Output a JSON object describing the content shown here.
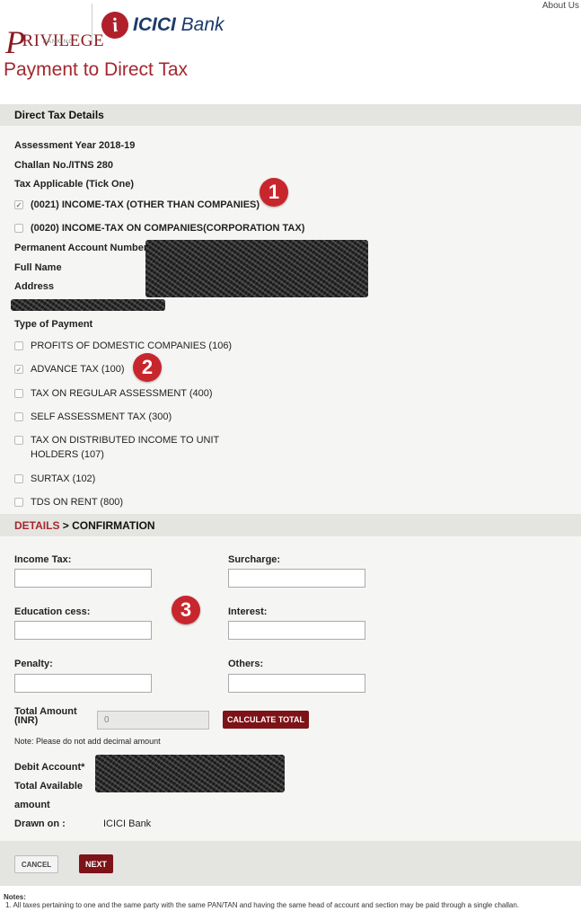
{
  "header": {
    "about_link": "About Us",
    "priv_logo_big": "P",
    "priv_logo_rest": "RIVILEGE",
    "priv_logo_sub": "BANKING",
    "icici_logo_mark": "i",
    "icici_logo_bold": "ICICI",
    "icici_logo_rest": " Bank"
  },
  "page_title": "Payment to Direct Tax",
  "direct_tax": {
    "section_title": "Direct Tax Details",
    "assessment_year": "Assessment Year 2018-19",
    "challan": "Challan No./ITNS 280",
    "tax_applicable_label": "Tax Applicable (Tick One)",
    "tax_options": [
      {
        "label": "(0021) INCOME-TAX (OTHER THAN COMPANIES)",
        "checked": true
      },
      {
        "label": "(0020) INCOME-TAX ON COMPANIES(CORPORATION TAX)",
        "checked": false
      }
    ],
    "pan_label": "Permanent Account Number",
    "full_name_label": "Full Name",
    "address_label": "Address",
    "type_of_payment_label": "Type of Payment",
    "payment_types": [
      {
        "label": "PROFITS OF DOMESTIC COMPANIES (106)",
        "checked": false
      },
      {
        "label": "ADVANCE TAX (100)",
        "checked": true
      },
      {
        "label": "TAX ON REGULAR ASSESSMENT (400)",
        "checked": false
      },
      {
        "label": "SELF ASSESSMENT TAX (300)",
        "checked": false
      },
      {
        "label": "TAX ON DISTRIBUTED INCOME TO UNIT",
        "label_line2": "HOLDERS (107)",
        "checked": false
      },
      {
        "label": "SURTAX (102)",
        "checked": false
      },
      {
        "label": "TDS ON RENT (800)",
        "checked": false
      }
    ]
  },
  "badges": [
    "1",
    "2",
    "3"
  ],
  "details": {
    "step_active": "DETAILS",
    "step_sep": " > ",
    "step_next": "CONFIRMATION",
    "income_tax_label": "Income Tax:",
    "surcharge_label": "Surcharge:",
    "education_cess_label": "Education cess:",
    "interest_label": "Interest:",
    "penalty_label": "Penalty:",
    "others_label": "Others:",
    "total_amount_label_1": "Total Amount",
    "total_amount_label_2": "(INR)",
    "total_amount_value": "0",
    "calculate_button": "CALCULATE TOTAL",
    "decimal_note": "Note: Please do not add decimal amount",
    "debit_account_label": "Debit Account*",
    "total_available_label_1": "Total Available",
    "total_available_label_2": "amount",
    "drawn_on_label": "Drawn on :",
    "drawn_on_value": "ICICI Bank"
  },
  "footer": {
    "cancel_button": "CANCEL",
    "next_button": "NEXT"
  },
  "notes": {
    "title": "Notes:",
    "item_1": "1. All taxes pertaining to one and the same party with the same PAN/TAN and having the same head of account and section may be paid through a single challan."
  },
  "colors": {
    "brand_red": "#a3282e",
    "button_red": "#7d1318",
    "badge_red": "#c8262d",
    "icici_blue": "#1d3a6a",
    "panel_bg": "#f5f5f3",
    "bar_bg": "#e4e4e1"
  }
}
